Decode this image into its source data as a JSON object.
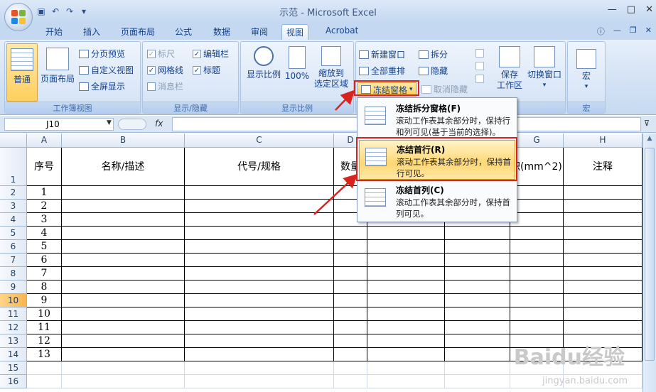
{
  "window": {
    "title": "示范 - Microsoft Excel"
  },
  "tabs": [
    "开始",
    "插入",
    "页面布局",
    "公式",
    "数据",
    "审阅",
    "视图",
    "Acrobat"
  ],
  "active_tab": "视图",
  "ribbon": {
    "workbook_views": {
      "label": "工作簿视图",
      "normal": "普通",
      "page_layout": "页面布局",
      "page_break": "分页预览",
      "custom_views": "自定义视图",
      "full_screen": "全屏显示"
    },
    "show_hide": {
      "label": "显示/隐藏",
      "ruler": "标尺",
      "gridlines": "网格线",
      "message_bar": "消息栏",
      "formula_bar": "编辑栏",
      "headings": "标题",
      "ruler_checked": true,
      "gridlines_checked": true,
      "message_bar_checked": false,
      "formula_bar_checked": true,
      "headings_checked": true
    },
    "zoom": {
      "label": "显示比例",
      "zoom": "显示比例",
      "zoom_100": "100%",
      "zoom_sel_line1": "缩放到",
      "zoom_sel_line2": "选定区域"
    },
    "window": {
      "label": "窗口",
      "new_window": "新建窗口",
      "arrange_all": "全部重排",
      "freeze_panes": "冻结窗格",
      "split": "拆分",
      "hide": "隐藏",
      "unhide": "取消隐藏",
      "save_workspace_line1": "保存",
      "save_workspace_line2": "工作区",
      "switch_windows": "切换窗口"
    },
    "macros": {
      "label": "宏",
      "macros": "宏"
    }
  },
  "formula_bar": {
    "name_box": "J10",
    "fx": "fx",
    "value": ""
  },
  "freeze_menu": {
    "items": [
      {
        "title": "冻结拆分窗格(F)",
        "desc": "滚动工作表其余部分时，保持行和列可见(基于当前的选择)。"
      },
      {
        "title": "冻结首行(R)",
        "desc": "滚动工作表其余部分时，保持首行可见。"
      },
      {
        "title": "冻结首列(C)",
        "desc": "滚动工作表其余部分时，保持首列可见。"
      }
    ],
    "highlighted_index": 1
  },
  "sheet": {
    "columns": [
      "A",
      "B",
      "C",
      "D",
      "E",
      "F",
      "G",
      "H"
    ],
    "header_row": [
      "序号",
      "名称/描述",
      "代号/规格",
      "数量",
      "",
      "",
      "积(mm^2)",
      "注释"
    ],
    "serials": [
      "1",
      "2",
      "3",
      "4",
      "5",
      "6",
      "7",
      "8",
      "9",
      "10",
      "11",
      "12",
      "13"
    ],
    "rows": [
      "1",
      "2",
      "3",
      "4",
      "5",
      "6",
      "7",
      "8",
      "9",
      "10",
      "11",
      "12",
      "13",
      "14",
      "15",
      "16"
    ],
    "active_cell": "J10"
  },
  "watermark": {
    "text": "Baidu经验",
    "url_text": "jingyan.baidu.com"
  }
}
